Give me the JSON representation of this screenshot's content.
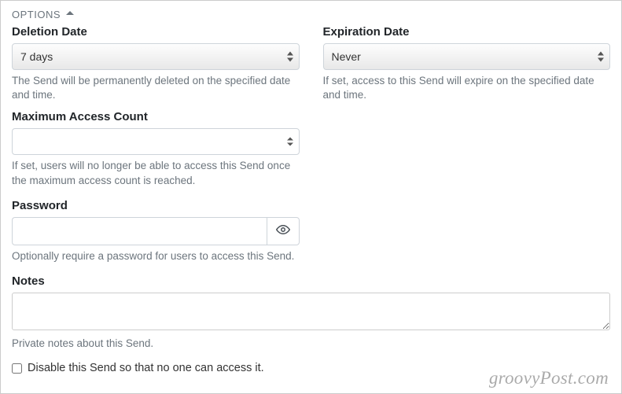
{
  "header": {
    "title": "OPTIONS"
  },
  "deletion": {
    "label": "Deletion Date",
    "value": "7 days",
    "help": "The Send will be permanently deleted on the specified date and time."
  },
  "expiration": {
    "label": "Expiration Date",
    "value": "Never",
    "help": "If set, access to this Send will expire on the specified date and time."
  },
  "maxAccess": {
    "label": "Maximum Access Count",
    "value": "",
    "help": "If set, users will no longer be able to access this Send once the maximum access count is reached."
  },
  "password": {
    "label": "Password",
    "value": "",
    "help": "Optionally require a password for users to access this Send."
  },
  "notes": {
    "label": "Notes",
    "value": "",
    "help": "Private notes about this Send."
  },
  "disable": {
    "label": "Disable this Send so that no one can access it."
  },
  "watermark": "groovyPost.com"
}
